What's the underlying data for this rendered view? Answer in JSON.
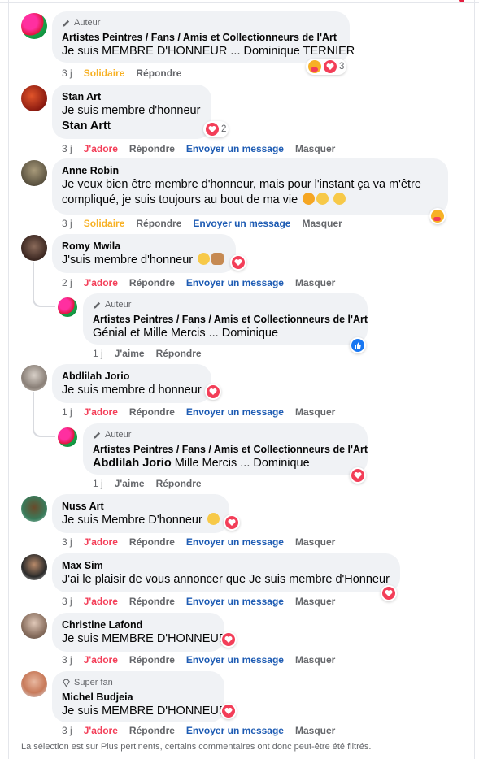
{
  "badges": {
    "author": "Auteur",
    "super_fan": "Super fan"
  },
  "actions": {
    "solidaire": "Solidaire",
    "adore": "J'adore",
    "aime": "J'aime",
    "reply": "Répondre",
    "message": "Envoyer un message",
    "hide": "Masquer"
  },
  "comments": [
    {
      "name": "Artistes Peintres / Fans / Amis et Collectionneurs de l'Art",
      "text": "Je suis MEMBRE D'HONNEUR ... Dominique TERNIER",
      "time": "3 j",
      "reaction_count": "3"
    },
    {
      "name": "Stan Art",
      "text": "Je suis membre d'honneur",
      "mention": "Stan Art",
      "mention_suffix": "t",
      "time": "3 j",
      "reaction_count": "2"
    },
    {
      "name": "Anne Robin",
      "text_line1": "Je veux bien être membre d'honneur, mais pour l'instant ça va m'être",
      "text_line2": "compliqué, je suis toujours au bout de ma vie",
      "time": "3 j"
    },
    {
      "name": "Romy Mwila",
      "text": "J'suis membre d'honneur",
      "time": "2 j"
    },
    {
      "name": "Artistes Peintres / Fans / Amis et Collectionneurs de l'Art",
      "text": "Génial et Mille Mercis ... Dominique",
      "time": "1 j"
    },
    {
      "name": "Abdlilah Jorio",
      "text": "Je suis membre d honneur",
      "time": "1 j"
    },
    {
      "name": "Artistes Peintres / Fans / Amis et Collectionneurs de l'Art",
      "mention": "Abdlilah Jorio",
      "text": "Mille Mercis ... Dominique",
      "time": "1 j"
    },
    {
      "name": "Nuss Art",
      "text": "Je suis Membre D'honneur",
      "time": "3 j"
    },
    {
      "name": "Max Sim",
      "text": "J'ai le plaisir de vous annoncer que Je suis membre d'Honneur",
      "time": "3 j"
    },
    {
      "name": "Christine Lafond",
      "text": "Je suis MEMBRE D'HONNEUR",
      "time": "3 j"
    },
    {
      "name": "Michel Budjeia",
      "text": "Je suis MEMBRE D'HONNEUR",
      "time": "3 j"
    }
  ],
  "footer": "La sélection est sur Plus pertinents, certains commentaires ont donc peut-être été filtrés.",
  "colors": {
    "adore": "#f33e58",
    "solidaire": "#f7b125",
    "message_link": "#1d5bb3",
    "bubble": "#f0f2f5",
    "like": "#1877f2"
  }
}
